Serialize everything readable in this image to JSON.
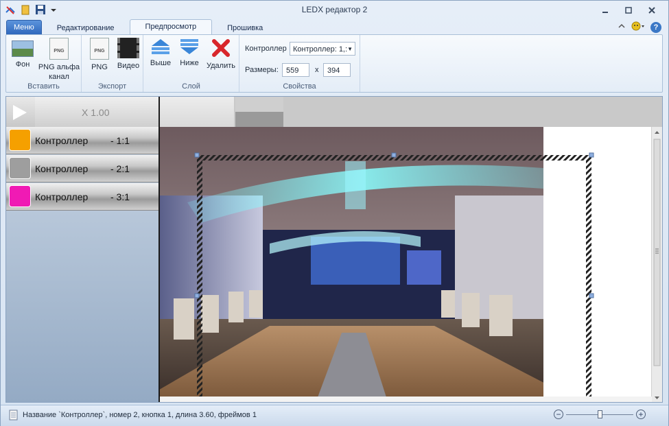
{
  "window": {
    "title": "LEDX редактор 2"
  },
  "quick_access": [
    "app-icon",
    "open-icon",
    "save-icon",
    "dropdown-icon"
  ],
  "tabs": [
    {
      "label": "Меню"
    },
    {
      "label": "Редактирование"
    },
    {
      "label": "Предпросмотр"
    },
    {
      "label": "Прошивка"
    }
  ],
  "ribbon": {
    "groups": {
      "insert": {
        "label": "Вставить",
        "bg_label": "Фон",
        "png_alpha_label": "PNG альфа канал"
      },
      "export": {
        "label": "Экспорт",
        "png_label": "PNG",
        "video_label": "Видео"
      },
      "layer": {
        "label": "Слой",
        "up_label": "Выше",
        "down_label": "Ниже",
        "delete_label": "Удалить"
      },
      "props": {
        "label": "Свойства",
        "controller_label": "Контроллер",
        "controller_value": "Контроллер: 1,:",
        "size_label": "Размеры:",
        "width": "559",
        "x_label": "x",
        "height": "394"
      }
    },
    "png_icon_text": "PNG"
  },
  "timeline": {
    "speed": "X 1.00"
  },
  "layers": [
    {
      "name": "Контроллер",
      "code": "- 1:1",
      "color": "#f5a000"
    },
    {
      "name": "Контроллер",
      "code": "- 2:1",
      "color": "#9e9e9e"
    },
    {
      "name": "Контроллер",
      "code": "- 3:1",
      "color": "#f01ab4"
    }
  ],
  "status": {
    "text": "Название `Контроллер`, номер 2, кнопка 1, длина 3.60, фреймов 1",
    "zoom_level": 0.5
  },
  "colors": {
    "accent": "#2f68bd",
    "selection_handle": "#8fb0e0"
  }
}
